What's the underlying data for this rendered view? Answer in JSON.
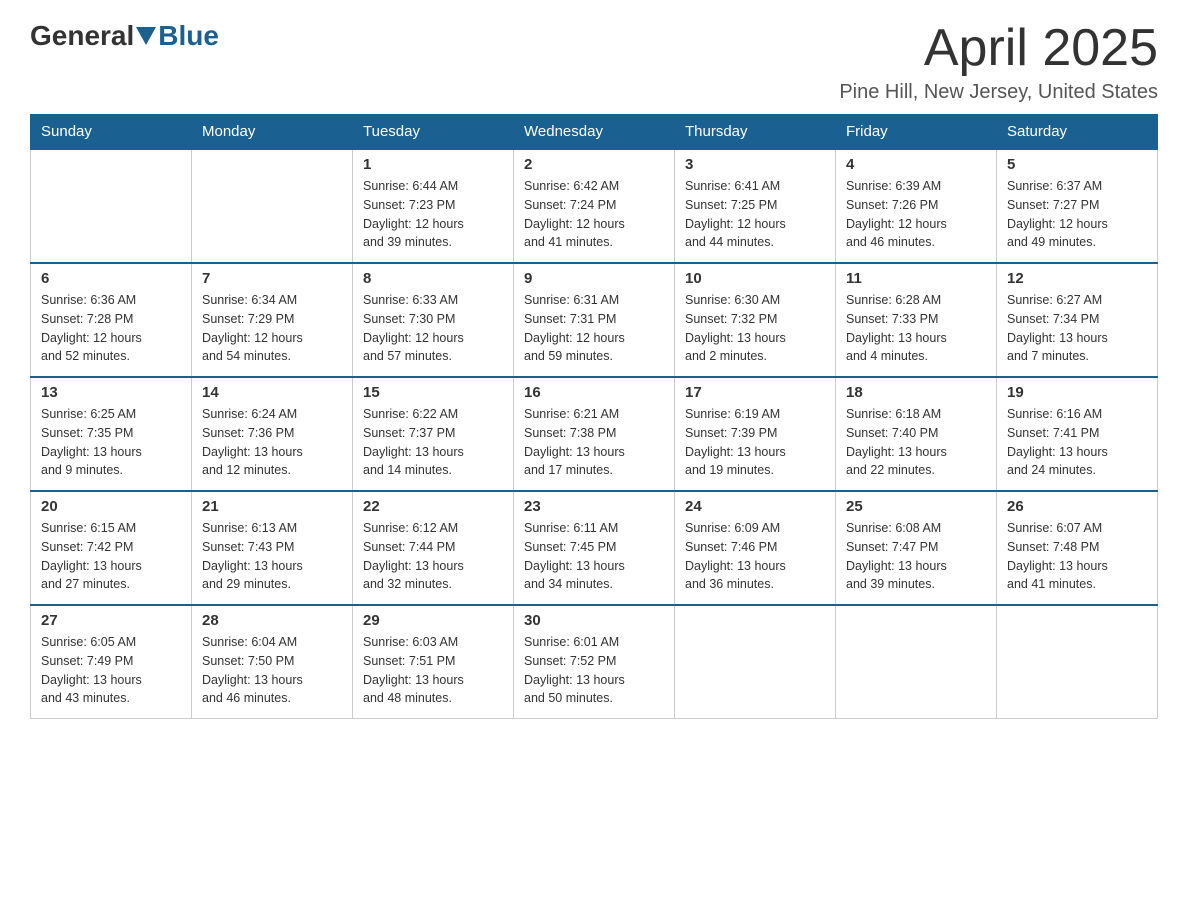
{
  "header": {
    "logo_general": "General",
    "logo_blue": "Blue",
    "month": "April 2025",
    "location": "Pine Hill, New Jersey, United States"
  },
  "days_of_week": [
    "Sunday",
    "Monday",
    "Tuesday",
    "Wednesday",
    "Thursday",
    "Friday",
    "Saturday"
  ],
  "weeks": [
    [
      {
        "day": "",
        "info": ""
      },
      {
        "day": "",
        "info": ""
      },
      {
        "day": "1",
        "info": "Sunrise: 6:44 AM\nSunset: 7:23 PM\nDaylight: 12 hours\nand 39 minutes."
      },
      {
        "day": "2",
        "info": "Sunrise: 6:42 AM\nSunset: 7:24 PM\nDaylight: 12 hours\nand 41 minutes."
      },
      {
        "day": "3",
        "info": "Sunrise: 6:41 AM\nSunset: 7:25 PM\nDaylight: 12 hours\nand 44 minutes."
      },
      {
        "day": "4",
        "info": "Sunrise: 6:39 AM\nSunset: 7:26 PM\nDaylight: 12 hours\nand 46 minutes."
      },
      {
        "day": "5",
        "info": "Sunrise: 6:37 AM\nSunset: 7:27 PM\nDaylight: 12 hours\nand 49 minutes."
      }
    ],
    [
      {
        "day": "6",
        "info": "Sunrise: 6:36 AM\nSunset: 7:28 PM\nDaylight: 12 hours\nand 52 minutes."
      },
      {
        "day": "7",
        "info": "Sunrise: 6:34 AM\nSunset: 7:29 PM\nDaylight: 12 hours\nand 54 minutes."
      },
      {
        "day": "8",
        "info": "Sunrise: 6:33 AM\nSunset: 7:30 PM\nDaylight: 12 hours\nand 57 minutes."
      },
      {
        "day": "9",
        "info": "Sunrise: 6:31 AM\nSunset: 7:31 PM\nDaylight: 12 hours\nand 59 minutes."
      },
      {
        "day": "10",
        "info": "Sunrise: 6:30 AM\nSunset: 7:32 PM\nDaylight: 13 hours\nand 2 minutes."
      },
      {
        "day": "11",
        "info": "Sunrise: 6:28 AM\nSunset: 7:33 PM\nDaylight: 13 hours\nand 4 minutes."
      },
      {
        "day": "12",
        "info": "Sunrise: 6:27 AM\nSunset: 7:34 PM\nDaylight: 13 hours\nand 7 minutes."
      }
    ],
    [
      {
        "day": "13",
        "info": "Sunrise: 6:25 AM\nSunset: 7:35 PM\nDaylight: 13 hours\nand 9 minutes."
      },
      {
        "day": "14",
        "info": "Sunrise: 6:24 AM\nSunset: 7:36 PM\nDaylight: 13 hours\nand 12 minutes."
      },
      {
        "day": "15",
        "info": "Sunrise: 6:22 AM\nSunset: 7:37 PM\nDaylight: 13 hours\nand 14 minutes."
      },
      {
        "day": "16",
        "info": "Sunrise: 6:21 AM\nSunset: 7:38 PM\nDaylight: 13 hours\nand 17 minutes."
      },
      {
        "day": "17",
        "info": "Sunrise: 6:19 AM\nSunset: 7:39 PM\nDaylight: 13 hours\nand 19 minutes."
      },
      {
        "day": "18",
        "info": "Sunrise: 6:18 AM\nSunset: 7:40 PM\nDaylight: 13 hours\nand 22 minutes."
      },
      {
        "day": "19",
        "info": "Sunrise: 6:16 AM\nSunset: 7:41 PM\nDaylight: 13 hours\nand 24 minutes."
      }
    ],
    [
      {
        "day": "20",
        "info": "Sunrise: 6:15 AM\nSunset: 7:42 PM\nDaylight: 13 hours\nand 27 minutes."
      },
      {
        "day": "21",
        "info": "Sunrise: 6:13 AM\nSunset: 7:43 PM\nDaylight: 13 hours\nand 29 minutes."
      },
      {
        "day": "22",
        "info": "Sunrise: 6:12 AM\nSunset: 7:44 PM\nDaylight: 13 hours\nand 32 minutes."
      },
      {
        "day": "23",
        "info": "Sunrise: 6:11 AM\nSunset: 7:45 PM\nDaylight: 13 hours\nand 34 minutes."
      },
      {
        "day": "24",
        "info": "Sunrise: 6:09 AM\nSunset: 7:46 PM\nDaylight: 13 hours\nand 36 minutes."
      },
      {
        "day": "25",
        "info": "Sunrise: 6:08 AM\nSunset: 7:47 PM\nDaylight: 13 hours\nand 39 minutes."
      },
      {
        "day": "26",
        "info": "Sunrise: 6:07 AM\nSunset: 7:48 PM\nDaylight: 13 hours\nand 41 minutes."
      }
    ],
    [
      {
        "day": "27",
        "info": "Sunrise: 6:05 AM\nSunset: 7:49 PM\nDaylight: 13 hours\nand 43 minutes."
      },
      {
        "day": "28",
        "info": "Sunrise: 6:04 AM\nSunset: 7:50 PM\nDaylight: 13 hours\nand 46 minutes."
      },
      {
        "day": "29",
        "info": "Sunrise: 6:03 AM\nSunset: 7:51 PM\nDaylight: 13 hours\nand 48 minutes."
      },
      {
        "day": "30",
        "info": "Sunrise: 6:01 AM\nSunset: 7:52 PM\nDaylight: 13 hours\nand 50 minutes."
      },
      {
        "day": "",
        "info": ""
      },
      {
        "day": "",
        "info": ""
      },
      {
        "day": "",
        "info": ""
      }
    ]
  ]
}
